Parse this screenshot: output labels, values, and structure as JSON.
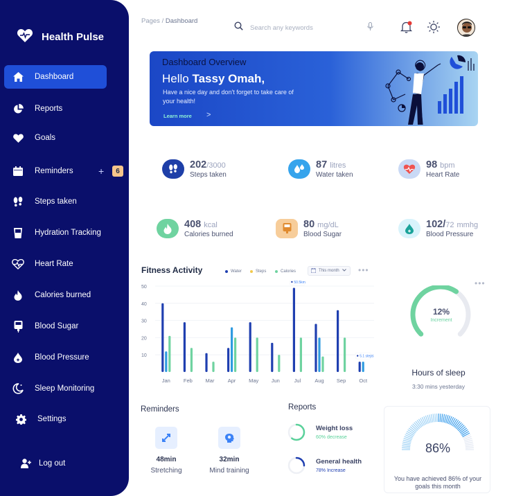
{
  "brand": {
    "name": "Health Pulse"
  },
  "sidebar": {
    "items": [
      {
        "label": "Dashboard"
      },
      {
        "label": "Reports"
      },
      {
        "label": "Goals"
      },
      {
        "label": "Reminders",
        "plus": "+",
        "badge": "6"
      },
      {
        "label": "Steps taken"
      },
      {
        "label": "Hydration Tracking"
      },
      {
        "label": "Heart Rate"
      },
      {
        "label": "Calories burned"
      },
      {
        "label": "Blood Sugar"
      },
      {
        "label": "Blood Pressure"
      },
      {
        "label": "Sleep Monitoring"
      },
      {
        "label": "Settings"
      },
      {
        "label": "Log out"
      }
    ]
  },
  "breadcrumb": {
    "root": "Pages",
    "sep": "/",
    "current": "Dashboard"
  },
  "search": {
    "placeholder": "Search any keywords"
  },
  "banner": {
    "title": "Dashboard Overview",
    "hello": "Hello",
    "name": "Tassy Omah,",
    "text": "Have a nice day and don't forget to take care of your health!",
    "link": "Learn more",
    "arrow": ">"
  },
  "stats": [
    {
      "value": "202",
      "unit": "/3000",
      "label": "Steps taken"
    },
    {
      "value": "87",
      "unit": "litres",
      "label": "Water taken"
    },
    {
      "value": "98",
      "unit": "bpm",
      "label": "Heart Rate"
    },
    {
      "value": "408",
      "unit": "kcal",
      "label": "Calories burned"
    },
    {
      "value": "80",
      "unit": "mg/dL",
      "label": "Blood Sugar"
    },
    {
      "value": "102/",
      "value2": "72",
      "unit": "mmhg",
      "label": "Blood Pressure"
    }
  ],
  "fitness": {
    "title": "Fitness Activity",
    "legend": [
      "Water",
      "Steps",
      "Calories"
    ],
    "select": "This month",
    "more": "•••"
  },
  "chart_data": {
    "type": "bar",
    "categories": [
      "Jan",
      "Feb",
      "Mar",
      "Apr",
      "May",
      "Jun",
      "Jul",
      "Aug",
      "Sep",
      "Oct"
    ],
    "series": [
      {
        "name": "Water",
        "color": "#1f3fb0",
        "values": [
          40,
          29,
          11,
          14,
          29,
          17,
          49,
          28,
          36,
          6
        ]
      },
      {
        "name": "Steps",
        "color": "#2f9be0",
        "values": [
          12,
          0,
          0,
          26,
          0,
          0,
          0,
          20,
          0,
          6
        ]
      },
      {
        "name": "Calories",
        "color": "#6fd3a0",
        "values": [
          21,
          14,
          6,
          20,
          20,
          10,
          20,
          9,
          20,
          0
        ]
      }
    ],
    "yticks": [
      10,
      20,
      30,
      40,
      50
    ],
    "ylim": [
      0,
      50
    ],
    "annotations": [
      {
        "category": "Jul",
        "text": "50.5km"
      },
      {
        "category": "Oct",
        "text": "5.1 steps"
      }
    ]
  },
  "sleep": {
    "percent": "12%",
    "sub": "Increment",
    "value": 0.33,
    "title": "Hours of sleep",
    "time": "3:30 mins yesterday",
    "more": "•••"
  },
  "reminders": {
    "title": "Reminders",
    "items": [
      {
        "value": "48min",
        "label": "Stretching"
      },
      {
        "value": "32min",
        "label": "Mind training"
      }
    ]
  },
  "reports": {
    "title": "Reports",
    "items": [
      {
        "name": "Weight loss",
        "sub": "60% decrease",
        "color": "#5ad19a",
        "value": 0.6
      },
      {
        "name": "General health",
        "sub": "78% Increase",
        "color": "#1f3fb0",
        "value": 0.25
      }
    ]
  },
  "goals": {
    "percent": "86%",
    "text": "You have achieved 86% of your goals this month",
    "value": 0.86
  }
}
